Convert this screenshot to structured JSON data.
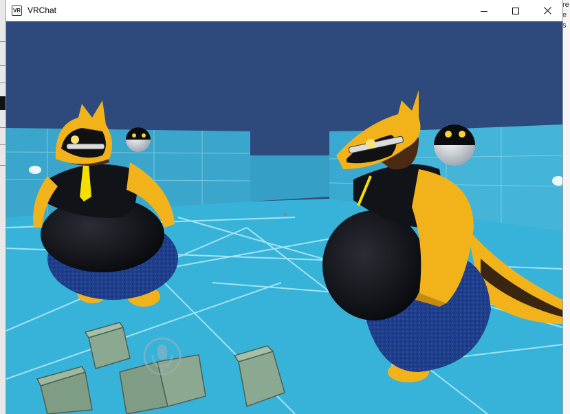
{
  "window": {
    "title": "VRChat",
    "app_icon_label": "VR",
    "controls": [
      "minimize",
      "maximize",
      "close"
    ]
  },
  "background_fragment_text": "re\ne\ns",
  "scene": {
    "description_icons": [
      "microphone-icon"
    ],
    "colors": {
      "sky": "#2e4a7d",
      "wall": "#3aa9cf",
      "floor": "#38b6dd",
      "grid": "#a8e3f2",
      "avatar_gold": "#f2b21a",
      "avatar_black": "#0d0f14",
      "avatar_jeans": "#1f3f8c",
      "tie_yellow": "#f3e000",
      "crate": "#7f9c84"
    }
  }
}
